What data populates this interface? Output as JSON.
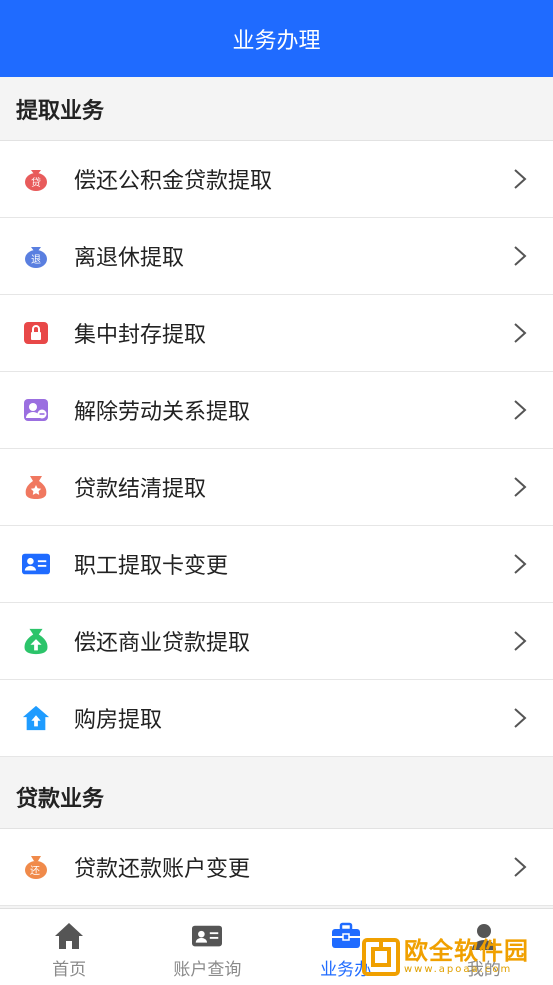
{
  "header": {
    "title": "业务办理"
  },
  "sections": [
    {
      "title": "提取业务",
      "items": [
        {
          "label": "偿还公积金贷款提取",
          "icon": "loan-bag-icon",
          "color": "#e85b5b",
          "glyph": "贷"
        },
        {
          "label": "离退休提取",
          "icon": "retire-bag-icon",
          "color": "#5a7fe0",
          "glyph": "退"
        },
        {
          "label": "集中封存提取",
          "icon": "lock-icon",
          "color": "#e84848"
        },
        {
          "label": "解除劳动关系提取",
          "icon": "user-remove-icon",
          "color": "#9b6fe0"
        },
        {
          "label": "贷款结清提取",
          "icon": "money-bag-icon",
          "color": "#f07860"
        },
        {
          "label": "职工提取卡变更",
          "icon": "id-card-icon",
          "color": "#1f6bff"
        },
        {
          "label": "偿还商业贷款提取",
          "icon": "upload-bag-icon",
          "color": "#2cc46a"
        },
        {
          "label": "购房提取",
          "icon": "house-icon",
          "color": "#1f9cff"
        }
      ]
    },
    {
      "title": "贷款业务",
      "items": [
        {
          "label": "贷款还款账户变更",
          "icon": "repay-bag-icon",
          "color": "#f08a4a",
          "glyph": "还"
        }
      ]
    }
  ],
  "tabbar": {
    "items": [
      {
        "label": "首页",
        "icon": "home-icon",
        "active": false
      },
      {
        "label": "账户查询",
        "icon": "account-card-icon",
        "active": false
      },
      {
        "label": "业务办",
        "icon": "briefcase-icon",
        "active": true
      },
      {
        "label": "我的",
        "icon": "person-icon",
        "active": false
      }
    ]
  },
  "watermark": {
    "main": "欧全软件园",
    "sub": "www.apoaa.com"
  },
  "colors": {
    "primary": "#1f6bff",
    "background": "#f4f4f4"
  }
}
